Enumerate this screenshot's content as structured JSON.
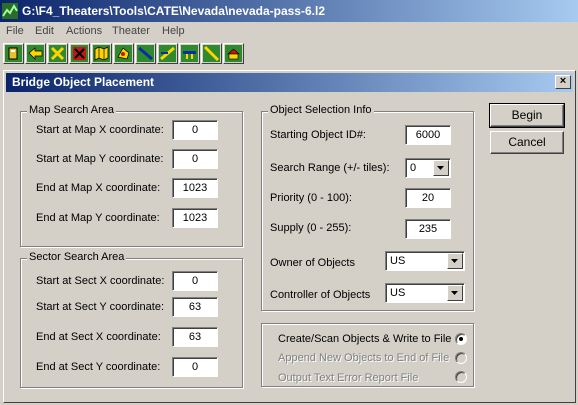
{
  "window": {
    "title": "G:\\F4_Theaters\\Tools\\CATE\\Nevada\\nevada-pass-6.l2"
  },
  "menu": [
    "File",
    "Edit",
    "Actions",
    "Theater",
    "Help"
  ],
  "toolbar_icons": [
    "open-icon",
    "back-arrow-icon",
    "cancel-x-icon",
    "stop-x-icon",
    "map-icon",
    "globe-icon",
    "line-tool-icon",
    "path-tool-icon",
    "bridge-icon",
    "slope-icon",
    "house-icon"
  ],
  "dialog": {
    "title": "Bridge Object Placement",
    "close_label": "×",
    "map_search": {
      "legend": "Map Search Area",
      "start_x_label": "Start at Map X coordinate:",
      "start_x": "0",
      "start_y_label": "Start at Map Y coordinate:",
      "start_y": "0",
      "end_x_label": "End at Map X coordinate:",
      "end_x": "1023",
      "end_y_label": "End at Map Y coordinate:",
      "end_y": "1023"
    },
    "sector_search": {
      "legend": "Sector Search Area",
      "start_x_label": "Start at Sect X coordinate:",
      "start_x": "0",
      "start_y_label": "Start at Sect Y coordinate:",
      "start_y": "63",
      "end_x_label": "End at Sect X coordinate:",
      "end_x": "63",
      "end_y_label": "End at Sect Y coordinate:",
      "end_y": "0"
    },
    "object_info": {
      "legend": "Object Selection Info",
      "start_id_label": "Starting Object ID#:",
      "start_id": "6000",
      "search_range_label": "Search Range (+/- tiles):",
      "search_range": "0",
      "priority_label": "Priority (0 - 100):",
      "priority": "20",
      "supply_label": "Supply (0 - 255):",
      "supply": "235",
      "owner_label": "Owner of Objects",
      "owner": "US",
      "controller_label": "Controller of Objects",
      "controller": "US"
    },
    "options": {
      "create_label": "Create/Scan Objects & Write to File",
      "append_label": "Append New Objects to End of File",
      "report_label": "Output Text Error Report File",
      "selected": "create"
    },
    "begin_label": "Begin",
    "cancel_label": "Cancel"
  }
}
